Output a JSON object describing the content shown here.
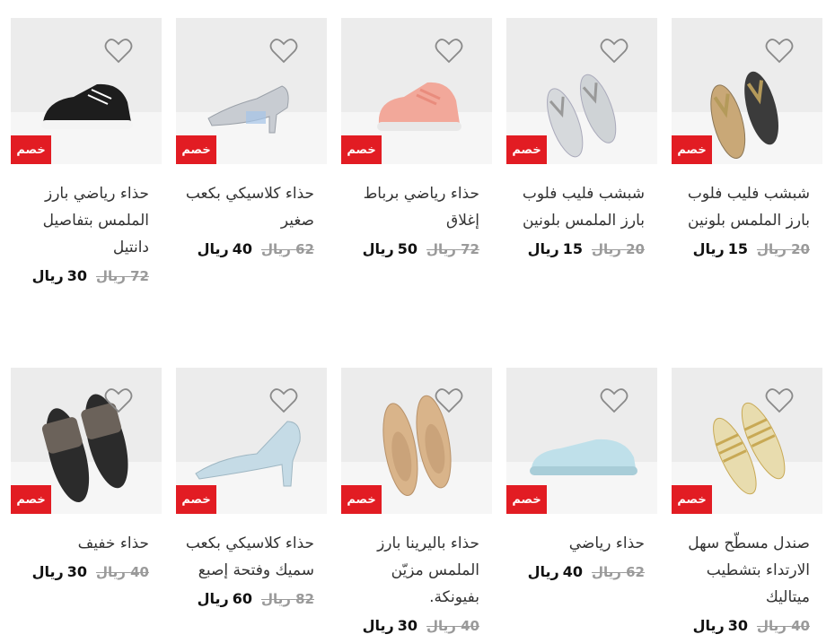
{
  "discount_label": "خصم",
  "currency": "ريال",
  "colors": {
    "badge": "#e21c23",
    "image_bg": "#ececec"
  },
  "products": [
    {
      "title": "شبشب فليب فلوب بارز الملمس بلونين",
      "old_price": "20",
      "new_price": "15",
      "image": "gold-flip-flop"
    },
    {
      "title": "شبشب فليب فلوب بارز الملمس بلونين",
      "old_price": "20",
      "new_price": "15",
      "image": "grey-flip-flop"
    },
    {
      "title": "حذاء رياضي برباط إغلاق",
      "old_price": "72",
      "new_price": "50",
      "image": "pink-sneaker"
    },
    {
      "title": "حذاء كلاسيكي بكعب صغير",
      "old_price": "62",
      "new_price": "40",
      "image": "silver-heel"
    },
    {
      "title": "حذاء رياضي بارز الملمس بتفاصيل دانتيل",
      "old_price": "72",
      "new_price": "30",
      "image": "black-sneaker"
    },
    {
      "title": "صندل مسطّح سهل الارتداء بتشطيب ميتاليك",
      "old_price": "40",
      "new_price": "30",
      "image": "gold-sandal"
    },
    {
      "title": "حذاء رياضي",
      "old_price": "62",
      "new_price": "40",
      "image": "blue-sneaker"
    },
    {
      "title": "حذاء باليرينا بارز الملمس مزيّن بفيونكة.",
      "old_price": "40",
      "new_price": "30",
      "image": "beige-ballerina"
    },
    {
      "title": "حذاء كلاسيكي بكعب سميك وفتحة إصبع",
      "old_price": "82",
      "new_price": "60",
      "image": "blue-heel"
    },
    {
      "title": "حذاء خفيف",
      "old_price": "40",
      "new_price": "30",
      "image": "black-slide"
    }
  ]
}
